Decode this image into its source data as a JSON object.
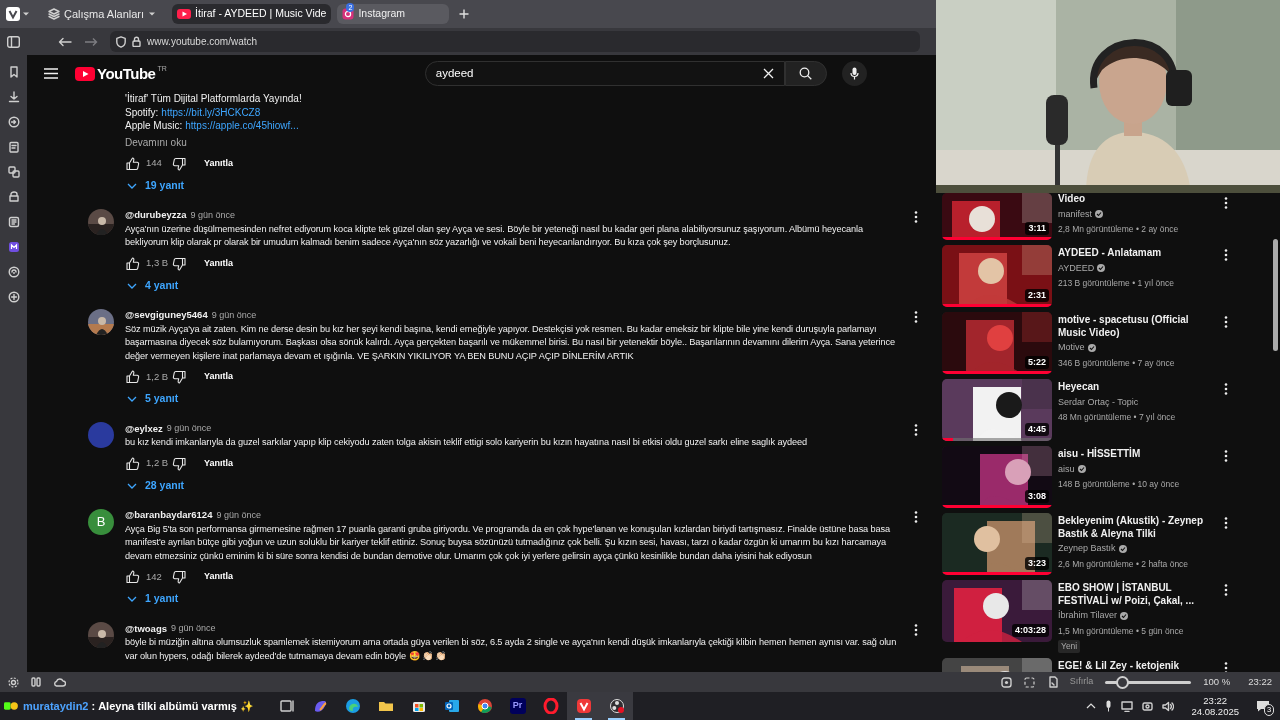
{
  "browser": {
    "workspaces": "Çalışma Alanları",
    "tabs": [
      {
        "title": "İtiraf - AYDEED | Music Vide",
        "selected": true,
        "kind": "video"
      },
      {
        "title": "Instagram",
        "selected": false,
        "kind": "camera",
        "badge": "2"
      }
    ],
    "address": "www.youtube.com/watch",
    "sidebar": [
      {
        "kind": "bookmark"
      },
      {
        "kind": "download"
      },
      {
        "kind": "history"
      },
      {
        "kind": "notes"
      },
      {
        "kind": "translate"
      },
      {
        "kind": "reading"
      },
      {
        "kind": "mail"
      },
      {
        "kind": "calendar"
      },
      {
        "kind": "feed"
      },
      {
        "kind": "add"
      }
    ]
  },
  "youtube": {
    "logo": "YouTube",
    "region": "TR",
    "search": {
      "value": "aydeed"
    }
  },
  "comments": [
    {
      "kind": "tail",
      "lines": [
        {
          "text": "'İtiraf' Tüm Dijital Platformlarda Yayında!"
        },
        {
          "text": "Spotify:",
          "link": "https://bit.ly/3HCKCZ8"
        },
        {
          "text": "Apple Music:",
          "link": "https://apple.co/45hiowf..."
        }
      ],
      "more": "Devamını oku",
      "likes": "144",
      "reply": "Yanıtla",
      "replies": "19 yanıt"
    },
    {
      "kind": "full",
      "author": "@durubeyzza",
      "time": "9 gün önce",
      "text": "Ayça'nın üzerine düşülmemesinden nefret ediyorum koca klipte tek güzel olan şey Ayça ve sesi. Böyle bir yeteneği nasıl bu kadar geri plana alabiliyorsunuz şaşıyorum. Albümü heyecanla bekliyorum klip olarak pr olarak bir umudum kalmadı benim sadece Ayça'nın söz yazarlığı ve vokali beni heyecanlandırıyor. Bu kıza çok şey borçlusunuz.",
      "likes": "1,3 B",
      "reply": "Yanıtla",
      "replies": "4 yanıt"
    },
    {
      "kind": "full",
      "author": "@sevgiguney5464",
      "time": "9 gün önce",
      "text": "Söz müzik Ayça'ya ait zaten. Kim ne derse desin bu kız her şeyi kendi başına, kendi emeğiyle yapıyor. Destekçisi yok resmen. Bu kadar emeksiz bir klipte bile yine kendi duruşuyla parlamayı başarmasına diyecek söz bulamıyorum. Başkası olsa sönük kalırdı. Ayça gerçekten başarılı ve mükemmel birisi. Bu nasıl bir yetenektir böyle.. Başarılarının devamını dilerim Ayça. Sana yeterince değer vermeyen kişilere inat parlamaya devam et ışığınla. VE ŞARKIN YIKILIYOR YA BEN BUNU AÇIP AÇIP DİNLERİM ARTIK",
      "likes": "1,2 B",
      "reply": "Yanıtla",
      "replies": "5 yanıt"
    },
    {
      "kind": "full",
      "author": "@eylxez",
      "time": "9 gün önce",
      "avatar": {
        "kind": "orb",
        "color": "#2a3a9e"
      },
      "text": "bu kız kendi imkanlarıyla da guzel sarkılar yapıp klip cekiyodu zaten tolga akisin teklif ettigi solo kariyerin bu kızın hayatına nasıl bi etkisi oldu guzel sarkı eline saglık aydeed",
      "likes": "1,2 B",
      "reply": "Yanıtla",
      "replies": "28 yanıt"
    },
    {
      "kind": "full",
      "author": "@baranbaydar6124",
      "time": "9 gün önce",
      "avatar": {
        "kind": "letter",
        "letter": "B",
        "color": "#388e3c"
      },
      "text": "Ayça Big 5'ta son performansa girmemesine rağmen 17 puanla garanti gruba giriyordu. Ve programda da en çok hype'lanan ve konuşulan kızlardan biriydi tartışmasız. Finalde üstüne basa basa manifest'e ayrılan bütçe gibi yoğun ve uzun soluklu bir kariyer teklif ettiniz. Sonuç buysa sözünüzü tutmadığınız çok belli. Şu kızın sesi, havası, tarzı o kadar özgün ki umarım bu kızı harcamaya devam etmezsiniz çünkü eminim ki bi süre sonra kendisi de bundan demotive olur. Umarım çok çok iyi yerlere gelirsin ayça çünkü kesinlikle bundan daha iyisini hak ediyosun",
      "likes": "142",
      "reply": "Yanıtla",
      "replies": "1 yanıt"
    },
    {
      "kind": "full",
      "author": "@twoags",
      "time": "9 gün önce",
      "text": "böyle bi müziğin altına olumsuzluk spamlemek istemiyorum ama ortada güya verilen bi söz, 6.5 ayda 2 single ve ayça'nın kendi düşük imkanlarıyla çektiği klibin hemen hemen aynısı var. sağ olun var olun hypers, odağı bilerek aydeed'de tutmamaya devam edin böyle 🤩 👏🏻 👏🏻"
    }
  ],
  "recommendations": [
    {
      "title": "Video",
      "channel": "manifest",
      "verified": true,
      "meta": "2,8 Mn görüntüleme • 2 ay önce",
      "duration": "3:11",
      "level": 1
    },
    {
      "title": "AYDEED - Anlatamam",
      "channel": "AYDEED",
      "verified": true,
      "meta": "213 B görüntüleme • 1 yıl önce",
      "duration": "2:31",
      "level": 1
    },
    {
      "title": "motive - spacetusu (Official Music Video)",
      "channel": "Motive",
      "verified": true,
      "meta": "346 B görüntüleme • 7 ay önce",
      "duration": "5:22",
      "level": 1
    },
    {
      "title": "Heyecan",
      "channel": "Serdar Ortaç - Topic",
      "verified": false,
      "meta": "48 Mn görüntüleme • 7 yıl önce",
      "duration": "4:45",
      "level": 0.1
    },
    {
      "title": "aisu - HİSSETTİM",
      "channel": "aisu",
      "verified": true,
      "meta": "148 B görüntüleme • 10 ay önce",
      "duration": "3:08",
      "level": 1
    },
    {
      "title": "Bekleyenim (Akustik) - Zeynep Bastık & Aleyna Tilki",
      "channel": "Zeynep Bastık",
      "verified": true,
      "meta": "2,6 Mn görüntüleme • 2 hafta önce",
      "duration": "3:23",
      "level": 1
    },
    {
      "title": "EBO SHOW | İSTANBUL FESTİVALİ w/ Poizi, Çakal, ...",
      "channel": "İbrahim Tilaver",
      "verified": true,
      "meta": "1,5 Mn görüntüleme • 5 gün önce",
      "duration": "4:03:28",
      "badge": "Yeni"
    },
    {
      "title": "EGE! & Lil Zey - ketojenik"
    }
  ],
  "status_bar": {
    "reset": "Sıfırla",
    "zoom": {
      "level": 0.2
    },
    "zoom_text": "100 %",
    "time": "23:22"
  },
  "taskbar": {
    "chat": {
      "user": "murataydin2",
      "separator": ":",
      "message": "Aleyna tilki albümü varmış",
      "emoji": "✨"
    },
    "apps": [
      {
        "kind": "taskview",
        "active": false
      },
      {
        "kind": "copilot",
        "active": false
      },
      {
        "kind": "edge",
        "active": false
      },
      {
        "kind": "folder",
        "active": false
      },
      {
        "kind": "store",
        "active": false
      },
      {
        "kind": "outlook",
        "active": false
      },
      {
        "kind": "chrome",
        "active": false
      },
      {
        "kind": "premiere",
        "label": "Pr",
        "active": false
      },
      {
        "kind": "opera",
        "active": false
      },
      {
        "kind": "vivaldi",
        "active": true
      },
      {
        "kind": "obs",
        "active": true
      }
    ],
    "clock": "23:22",
    "date": "24.08.2025",
    "notifications": "3"
  }
}
